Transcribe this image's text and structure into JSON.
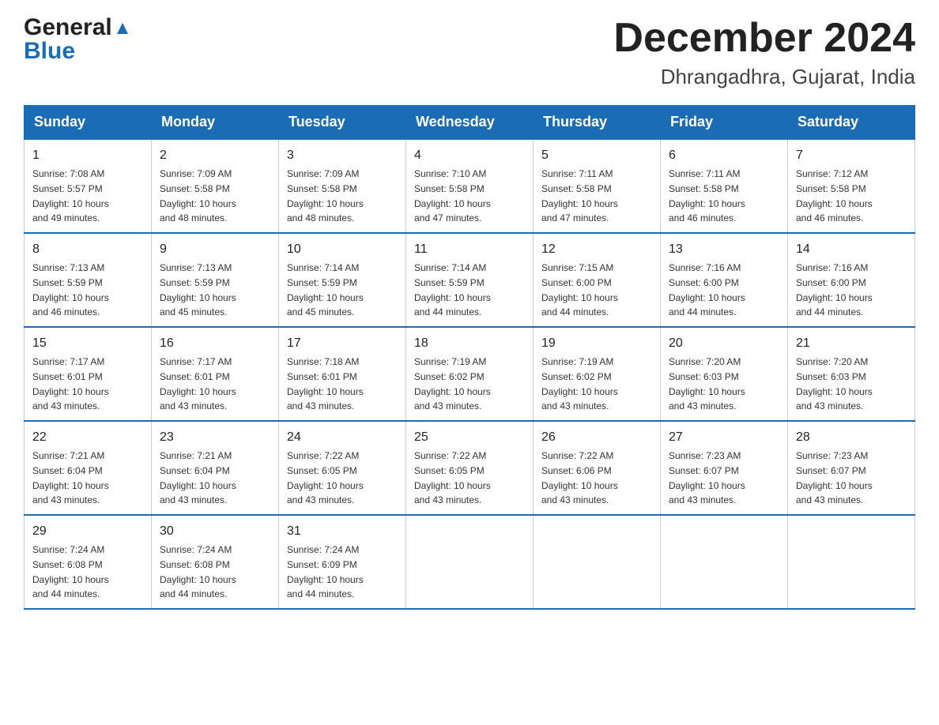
{
  "header": {
    "logo_general": "General",
    "logo_blue": "Blue",
    "month_title": "December 2024",
    "location": "Dhrangadhra, Gujarat, India"
  },
  "days_of_week": [
    "Sunday",
    "Monday",
    "Tuesday",
    "Wednesday",
    "Thursday",
    "Friday",
    "Saturday"
  ],
  "weeks": [
    [
      {
        "day": "1",
        "sunrise": "7:08 AM",
        "sunset": "5:57 PM",
        "daylight": "10 hours and 49 minutes."
      },
      {
        "day": "2",
        "sunrise": "7:09 AM",
        "sunset": "5:58 PM",
        "daylight": "10 hours and 48 minutes."
      },
      {
        "day": "3",
        "sunrise": "7:09 AM",
        "sunset": "5:58 PM",
        "daylight": "10 hours and 48 minutes."
      },
      {
        "day": "4",
        "sunrise": "7:10 AM",
        "sunset": "5:58 PM",
        "daylight": "10 hours and 47 minutes."
      },
      {
        "day": "5",
        "sunrise": "7:11 AM",
        "sunset": "5:58 PM",
        "daylight": "10 hours and 47 minutes."
      },
      {
        "day": "6",
        "sunrise": "7:11 AM",
        "sunset": "5:58 PM",
        "daylight": "10 hours and 46 minutes."
      },
      {
        "day": "7",
        "sunrise": "7:12 AM",
        "sunset": "5:58 PM",
        "daylight": "10 hours and 46 minutes."
      }
    ],
    [
      {
        "day": "8",
        "sunrise": "7:13 AM",
        "sunset": "5:59 PM",
        "daylight": "10 hours and 46 minutes."
      },
      {
        "day": "9",
        "sunrise": "7:13 AM",
        "sunset": "5:59 PM",
        "daylight": "10 hours and 45 minutes."
      },
      {
        "day": "10",
        "sunrise": "7:14 AM",
        "sunset": "5:59 PM",
        "daylight": "10 hours and 45 minutes."
      },
      {
        "day": "11",
        "sunrise": "7:14 AM",
        "sunset": "5:59 PM",
        "daylight": "10 hours and 44 minutes."
      },
      {
        "day": "12",
        "sunrise": "7:15 AM",
        "sunset": "6:00 PM",
        "daylight": "10 hours and 44 minutes."
      },
      {
        "day": "13",
        "sunrise": "7:16 AM",
        "sunset": "6:00 PM",
        "daylight": "10 hours and 44 minutes."
      },
      {
        "day": "14",
        "sunrise": "7:16 AM",
        "sunset": "6:00 PM",
        "daylight": "10 hours and 44 minutes."
      }
    ],
    [
      {
        "day": "15",
        "sunrise": "7:17 AM",
        "sunset": "6:01 PM",
        "daylight": "10 hours and 43 minutes."
      },
      {
        "day": "16",
        "sunrise": "7:17 AM",
        "sunset": "6:01 PM",
        "daylight": "10 hours and 43 minutes."
      },
      {
        "day": "17",
        "sunrise": "7:18 AM",
        "sunset": "6:01 PM",
        "daylight": "10 hours and 43 minutes."
      },
      {
        "day": "18",
        "sunrise": "7:19 AM",
        "sunset": "6:02 PM",
        "daylight": "10 hours and 43 minutes."
      },
      {
        "day": "19",
        "sunrise": "7:19 AM",
        "sunset": "6:02 PM",
        "daylight": "10 hours and 43 minutes."
      },
      {
        "day": "20",
        "sunrise": "7:20 AM",
        "sunset": "6:03 PM",
        "daylight": "10 hours and 43 minutes."
      },
      {
        "day": "21",
        "sunrise": "7:20 AM",
        "sunset": "6:03 PM",
        "daylight": "10 hours and 43 minutes."
      }
    ],
    [
      {
        "day": "22",
        "sunrise": "7:21 AM",
        "sunset": "6:04 PM",
        "daylight": "10 hours and 43 minutes."
      },
      {
        "day": "23",
        "sunrise": "7:21 AM",
        "sunset": "6:04 PM",
        "daylight": "10 hours and 43 minutes."
      },
      {
        "day": "24",
        "sunrise": "7:22 AM",
        "sunset": "6:05 PM",
        "daylight": "10 hours and 43 minutes."
      },
      {
        "day": "25",
        "sunrise": "7:22 AM",
        "sunset": "6:05 PM",
        "daylight": "10 hours and 43 minutes."
      },
      {
        "day": "26",
        "sunrise": "7:22 AM",
        "sunset": "6:06 PM",
        "daylight": "10 hours and 43 minutes."
      },
      {
        "day": "27",
        "sunrise": "7:23 AM",
        "sunset": "6:07 PM",
        "daylight": "10 hours and 43 minutes."
      },
      {
        "day": "28",
        "sunrise": "7:23 AM",
        "sunset": "6:07 PM",
        "daylight": "10 hours and 43 minutes."
      }
    ],
    [
      {
        "day": "29",
        "sunrise": "7:24 AM",
        "sunset": "6:08 PM",
        "daylight": "10 hours and 44 minutes."
      },
      {
        "day": "30",
        "sunrise": "7:24 AM",
        "sunset": "6:08 PM",
        "daylight": "10 hours and 44 minutes."
      },
      {
        "day": "31",
        "sunrise": "7:24 AM",
        "sunset": "6:09 PM",
        "daylight": "10 hours and 44 minutes."
      },
      null,
      null,
      null,
      null
    ]
  ],
  "labels": {
    "sunrise": "Sunrise:",
    "sunset": "Sunset:",
    "daylight": "Daylight:"
  }
}
